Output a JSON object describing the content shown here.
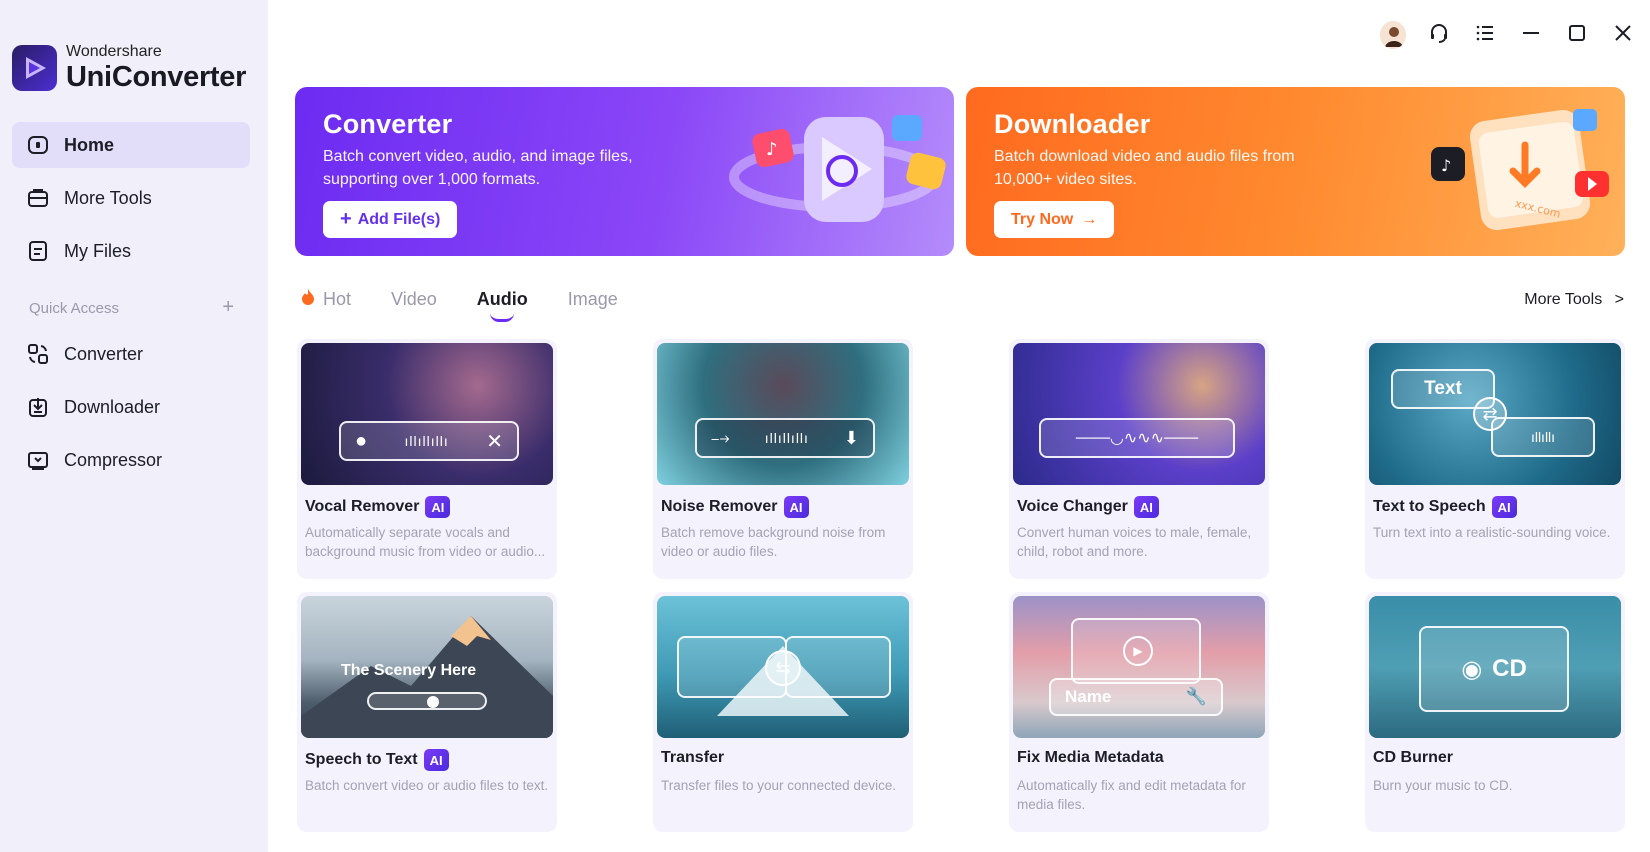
{
  "app": {
    "brand_small": "Wondershare",
    "brand_name": "UniConverter"
  },
  "sidebar": {
    "items": [
      {
        "label": "Home",
        "icon": "home-icon"
      },
      {
        "label": "More Tools",
        "icon": "toolbox-icon"
      },
      {
        "label": "My Files",
        "icon": "files-icon"
      }
    ],
    "quick_access_label": "Quick Access",
    "quick_access_plus": "+",
    "quick_items": [
      {
        "label": "Converter",
        "icon": "converter-icon"
      },
      {
        "label": "Downloader",
        "icon": "downloader-icon"
      },
      {
        "label": "Compressor",
        "icon": "compressor-icon"
      }
    ]
  },
  "window_controls": [
    "avatar",
    "headset-icon",
    "menu-icon",
    "minimize-icon",
    "maximize-icon",
    "close-icon"
  ],
  "banners": {
    "converter": {
      "title": "Converter",
      "desc": "Batch convert video, audio, and image files, supporting over 1,000 formats.",
      "cta": "Add File(s)",
      "cta_prefix": "+"
    },
    "downloader": {
      "title": "Downloader",
      "desc": "Batch download video and audio files from 10,000+ video sites.",
      "cta": "Try Now",
      "cta_suffix": "→",
      "art_text": "xxx.com"
    }
  },
  "tabs": {
    "items": [
      "Hot",
      "Video",
      "Audio",
      "Image"
    ],
    "active": "Audio",
    "more_tools": "More Tools",
    "more_chevron": ">"
  },
  "cards": [
    {
      "title": "Vocal Remover",
      "ai": "AI",
      "desc": "Automatically separate vocals and background music from video or audio..."
    },
    {
      "title": "Noise Remover",
      "ai": "AI",
      "desc": "Batch remove background noise from video or audio files."
    },
    {
      "title": "Voice Changer",
      "ai": "AI",
      "desc": "Convert human voices to male, female, child, robot and more."
    },
    {
      "title": "Text to Speech",
      "ai": "AI",
      "desc": "Turn text into a realistic-sounding voice.",
      "thumb_text": "Text"
    },
    {
      "title": "Speech to Text",
      "ai": "AI",
      "desc": "Batch convert video or audio files to text.",
      "thumb_text": "The Scenery Here"
    },
    {
      "title": "Transfer",
      "ai": "",
      "desc": "Transfer files to your connected device."
    },
    {
      "title": "Fix Media Metadata",
      "ai": "",
      "desc": "Automatically fix and edit metadata for media files.",
      "thumb_text": "Name"
    },
    {
      "title": "CD Burner",
      "ai": "",
      "desc": "Burn your music to CD.",
      "thumb_text": "CD"
    }
  ],
  "colors": {
    "accent": "#6d2bf2",
    "orange": "#ff7a24",
    "sidebar_bg": "#f1effa"
  }
}
